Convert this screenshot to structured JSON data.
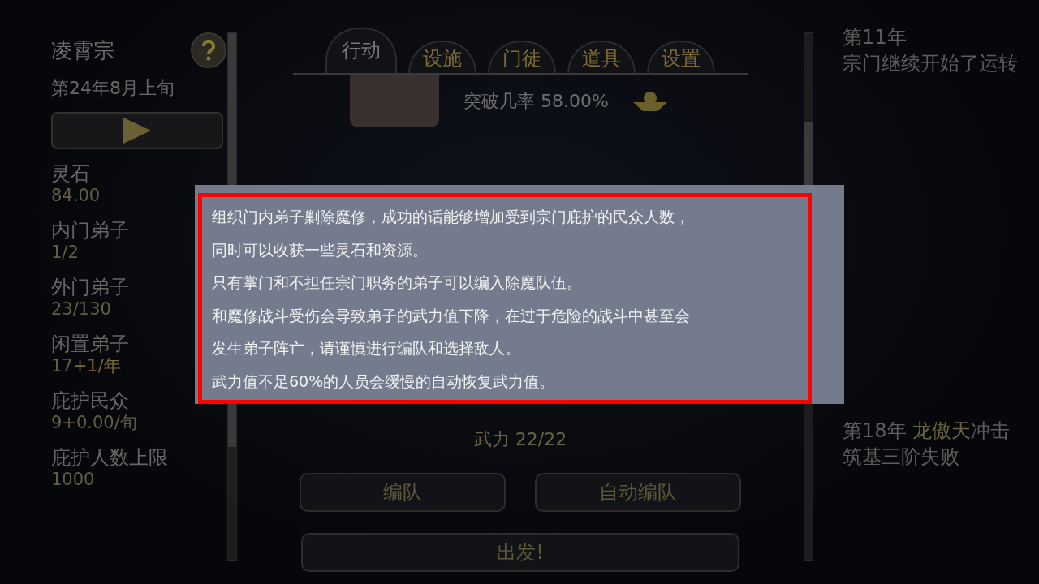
{
  "sidebar": {
    "sect_name": "凌霄宗",
    "date": "第24年8月上旬",
    "stats": [
      {
        "label": "灵石",
        "value": "84.00"
      },
      {
        "label": "内门弟子",
        "value": "1/2"
      },
      {
        "label": "外门弟子",
        "value": "23/130"
      },
      {
        "label": "闲置弟子",
        "value": "17",
        "bonus": "+1/年"
      },
      {
        "label": "庇护民众",
        "value": "9+0.00/旬"
      },
      {
        "label": "庇护人数上限",
        "value": "1000"
      }
    ]
  },
  "tabs": [
    {
      "label": "行动",
      "selected": true
    },
    {
      "label": "设施",
      "selected": false
    },
    {
      "label": "门徒",
      "selected": false
    },
    {
      "label": "道具",
      "selected": false
    },
    {
      "label": "设置",
      "selected": false
    }
  ],
  "breakthrough": "突破几率 58.00%",
  "force": "武力 22/22",
  "buttons": [
    "编队",
    "自动编队"
  ],
  "start_button": "出发!",
  "tooltip": {
    "lines": [
      "组织门内弟子剿除魔修，成功的话能够增加受到宗门庇护的民众人数，",
      "同时可以收获一些灵石和资源。",
      "只有掌门和不担任宗门职务的弟子可以编入除魔队伍。",
      "和魔修战斗受伤会导致弟子的武力值下降，在过于危险的战斗中甚至会",
      "发生弟子阵亡，请谨慎进行编队和选择敌人。",
      "武力值不足60%的人员会缓慢的自动恢复武力值。"
    ]
  },
  "log": [
    {
      "kind": "block",
      "year": "第11年",
      "text": "宗门继续开始了运转"
    },
    {
      "kind": "inline",
      "year": "第18年",
      "actor": "龙傲天",
      "text": "冲击筑基三阶失败"
    }
  ]
}
